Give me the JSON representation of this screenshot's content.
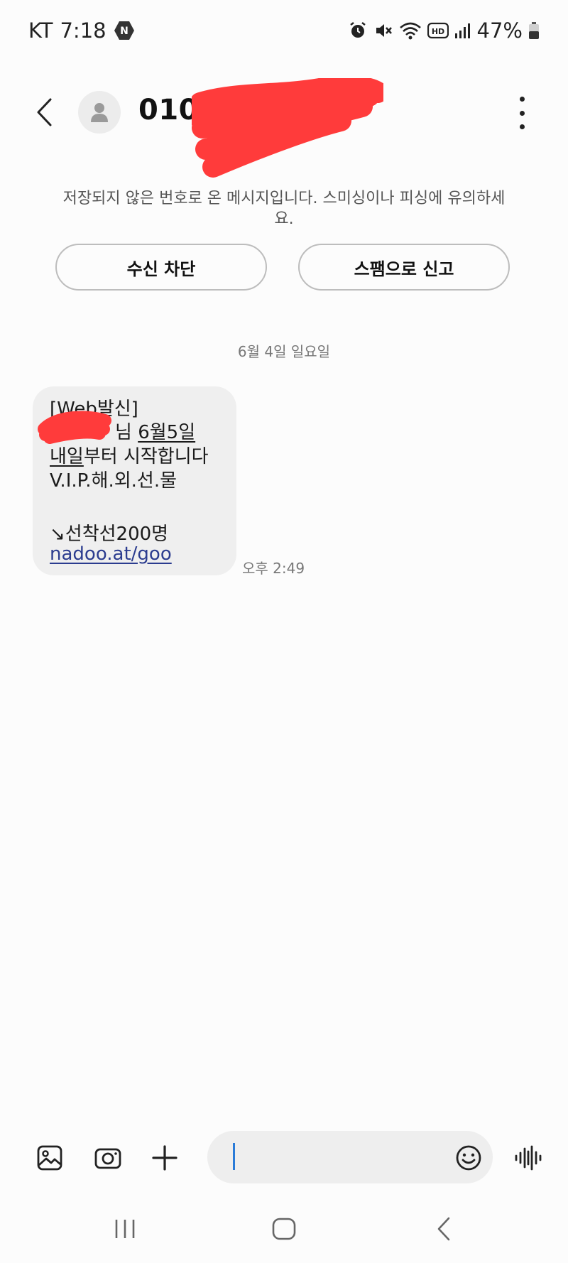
{
  "status_bar": {
    "carrier": "KT",
    "time": "7:18",
    "battery": "47%"
  },
  "header": {
    "contact_number": "010-"
  },
  "warning": {
    "text": "저장되지 않은 번호로 온 메시지입니다. 스미싱이나 피싱에 유의하세요."
  },
  "actions": {
    "block_label": "수신 차단",
    "spam_label": "스팸으로 신고"
  },
  "conversation": {
    "date": "6월 4일 일요일",
    "message": {
      "line1": "[Web발신]",
      "line2_suffix": "님 ",
      "line2_underlined": "6월5일",
      "line3_underlined": "내일",
      "line3_rest": "부터 시작합니다",
      "line4": " V.I.P.해.외.선.물",
      "line5": "↘선착선200명",
      "link": "nadoo.at/goo",
      "time": "오후 2:49"
    }
  },
  "composer": {
    "input_value": ""
  },
  "colors": {
    "background": "#fcfcfc",
    "bubble": "#efefef",
    "link": "#2b3c8f",
    "redaction": "#ff3b3b",
    "cursor": "#2a7bd8"
  },
  "icons": [
    "n-badge-icon",
    "alarm-icon",
    "mute-icon",
    "wifi-icon",
    "hd-icon",
    "signal-icon",
    "battery-icon",
    "back-arrow-icon",
    "person-icon",
    "more-vert-icon",
    "gallery-icon",
    "camera-icon",
    "plus-icon",
    "emoji-icon",
    "voice-wave-icon",
    "nav-recents-icon",
    "nav-home-icon",
    "nav-back-icon"
  ]
}
